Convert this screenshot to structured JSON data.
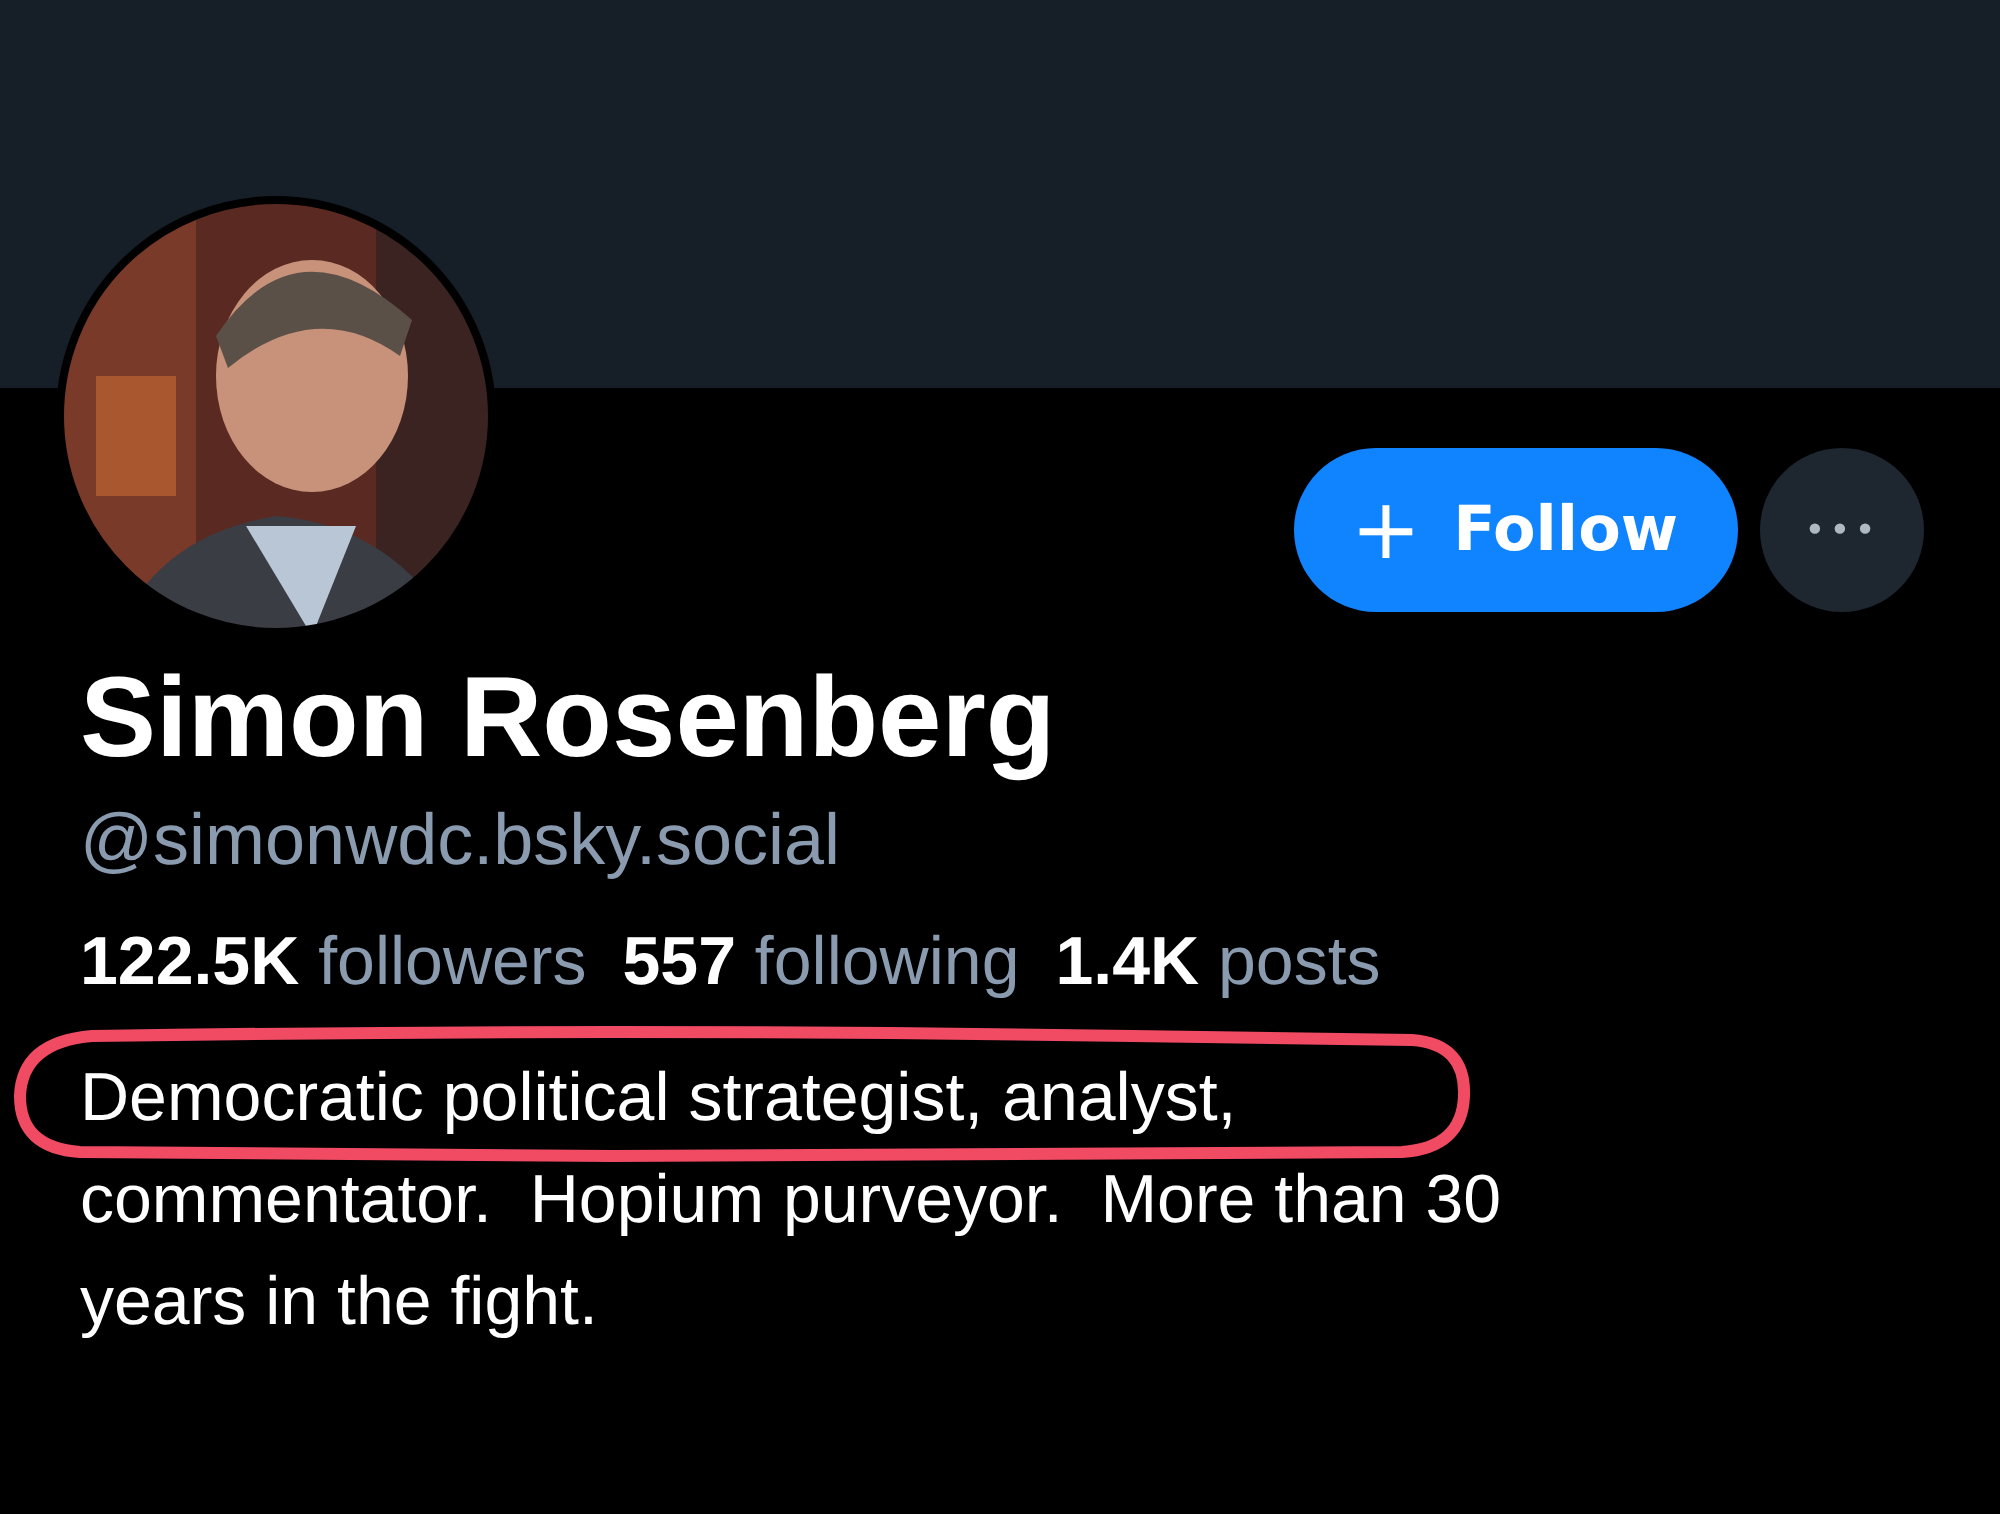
{
  "profile": {
    "name": "Simon Rosenberg",
    "handle": "@simonwdc.bsky.social"
  },
  "actions": {
    "follow": {
      "icon": "+",
      "label": "Follow"
    },
    "more": "•••"
  },
  "stats": [
    {
      "count": "122.5K",
      "label": "followers"
    },
    {
      "count": "557",
      "label": "following"
    },
    {
      "count": "1.4K",
      "label": "posts"
    }
  ],
  "bio": [
    "Democratic political strategist, analyst,",
    "commentator.  Hopium purveyor.  More than 30",
    "years in the fight."
  ]
}
